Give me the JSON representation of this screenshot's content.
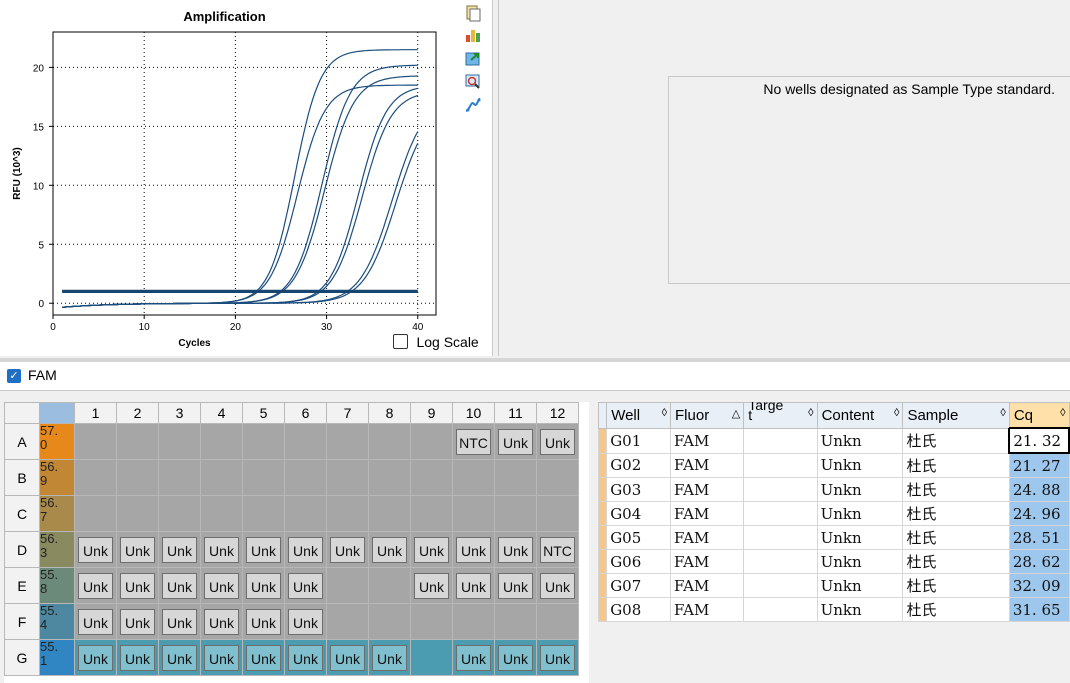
{
  "chart_data": {
    "type": "line",
    "title": "Amplification",
    "xlabel": "Cycles",
    "ylabel": "RFU (10^3)",
    "xlim": [
      0,
      42
    ],
    "ylim": [
      -1,
      23
    ],
    "x_ticks": [
      0,
      10,
      20,
      30,
      40
    ],
    "y_ticks": [
      0,
      5,
      10,
      15,
      20
    ],
    "grid": true,
    "series": [
      {
        "plateau": 21.5,
        "midpoint": 26.5,
        "slope": 1.4
      },
      {
        "plateau": 18.5,
        "midpoint": 26.8,
        "slope": 1.5
      },
      {
        "plateau": 20.2,
        "midpoint": 29.5,
        "slope": 1.55
      },
      {
        "plateau": 19.3,
        "midpoint": 29.8,
        "slope": 1.6
      },
      {
        "plateau": 18.5,
        "midpoint": 33.5,
        "slope": 1.55
      },
      {
        "plateau": 18.0,
        "midpoint": 33.9,
        "slope": 1.6
      },
      {
        "plateau": 17.5,
        "midpoint": 37.2,
        "slope": 1.75
      },
      {
        "plateau": 17.0,
        "midpoint": 37.6,
        "slope": 1.75
      },
      {
        "plateau": 1.05,
        "midpoint": 0,
        "slope": 1,
        "flat": true
      },
      {
        "plateau": 0.95,
        "midpoint": 0,
        "slope": 1,
        "flat": true
      }
    ]
  },
  "log_scale_label": "Log Scale",
  "std_message": "No wells designated as Sample Type standard.",
  "fluor_filter": "FAM",
  "plate": {
    "columns": [
      "1",
      "2",
      "3",
      "4",
      "5",
      "6",
      "7",
      "8",
      "9",
      "10",
      "11",
      "12"
    ],
    "rows": [
      {
        "label": "A",
        "temp": "57.\n0",
        "temp_color": "#e6891a",
        "wells": [
          "",
          "",
          "",
          "",
          "",
          "",
          "",
          "",
          "",
          "NTC",
          "Unk",
          "Unk"
        ]
      },
      {
        "label": "B",
        "temp": "56.\n9",
        "temp_color": "#c28735",
        "wells": [
          "",
          "",
          "",
          "",
          "",
          "",
          "",
          "",
          "",
          "",
          "",
          ""
        ]
      },
      {
        "label": "C",
        "temp": "56.\n7",
        "temp_color": "#a98a4b",
        "wells": [
          "",
          "",
          "",
          "",
          "",
          "",
          "",
          "",
          "",
          "",
          "",
          ""
        ]
      },
      {
        "label": "D",
        "temp": "56.\n3",
        "temp_color": "#8a8a60",
        "wells": [
          "Unk",
          "Unk",
          "Unk",
          "Unk",
          "Unk",
          "Unk",
          "Unk",
          "Unk",
          "Unk",
          "Unk",
          "Unk",
          "NTC"
        ]
      },
      {
        "label": "E",
        "temp": "55.\n8",
        "temp_color": "#6b8a7a",
        "wells": [
          "Unk",
          "Unk",
          "Unk",
          "Unk",
          "Unk",
          "Unk",
          "",
          "",
          "Unk",
          "Unk",
          "Unk",
          "Unk"
        ]
      },
      {
        "label": "F",
        "temp": "55.\n4",
        "temp_color": "#4d88a0",
        "wells": [
          "Unk",
          "Unk",
          "Unk",
          "Unk",
          "Unk",
          "Unk",
          "",
          "",
          "",
          "",
          "",
          ""
        ]
      },
      {
        "label": "G",
        "temp": "55.\n1",
        "temp_color": "#2f86c2",
        "wells": [
          "Unk",
          "Unk",
          "Unk",
          "Unk",
          "Unk",
          "Unk",
          "Unk",
          "Unk",
          "",
          "Unk",
          "Unk",
          "Unk"
        ],
        "selected": true
      }
    ]
  },
  "results": {
    "headers": [
      "Well",
      "Fluor",
      "Targe\nt",
      "Content",
      "Sample",
      "Cq"
    ],
    "rows": [
      {
        "well": "G01",
        "fluor": "FAM",
        "target": "",
        "content": "Unkn",
        "sample": "杜氏",
        "cq": "21. 32"
      },
      {
        "well": "G02",
        "fluor": "FAM",
        "target": "",
        "content": "Unkn",
        "sample": "杜氏",
        "cq": "21. 27"
      },
      {
        "well": "G03",
        "fluor": "FAM",
        "target": "",
        "content": "Unkn",
        "sample": "杜氏",
        "cq": "24. 88"
      },
      {
        "well": "G04",
        "fluor": "FAM",
        "target": "",
        "content": "Unkn",
        "sample": "杜氏",
        "cq": "24. 96"
      },
      {
        "well": "G05",
        "fluor": "FAM",
        "target": "",
        "content": "Unkn",
        "sample": "杜氏",
        "cq": "28. 51"
      },
      {
        "well": "G06",
        "fluor": "FAM",
        "target": "",
        "content": "Unkn",
        "sample": "杜氏",
        "cq": "28. 62"
      },
      {
        "well": "G07",
        "fluor": "FAM",
        "target": "",
        "content": "Unkn",
        "sample": "杜氏",
        "cq": "32. 09"
      },
      {
        "well": "G08",
        "fluor": "FAM",
        "target": "",
        "content": "Unkn",
        "sample": "杜氏",
        "cq": "31. 65"
      }
    ]
  },
  "colors": {
    "curve": "#1b4d7e",
    "flat": "#16466f"
  },
  "toolbar_icons": [
    "copy-icon",
    "chart-settings-icon",
    "export-icon",
    "zoom-icon",
    "trace-icon"
  ]
}
